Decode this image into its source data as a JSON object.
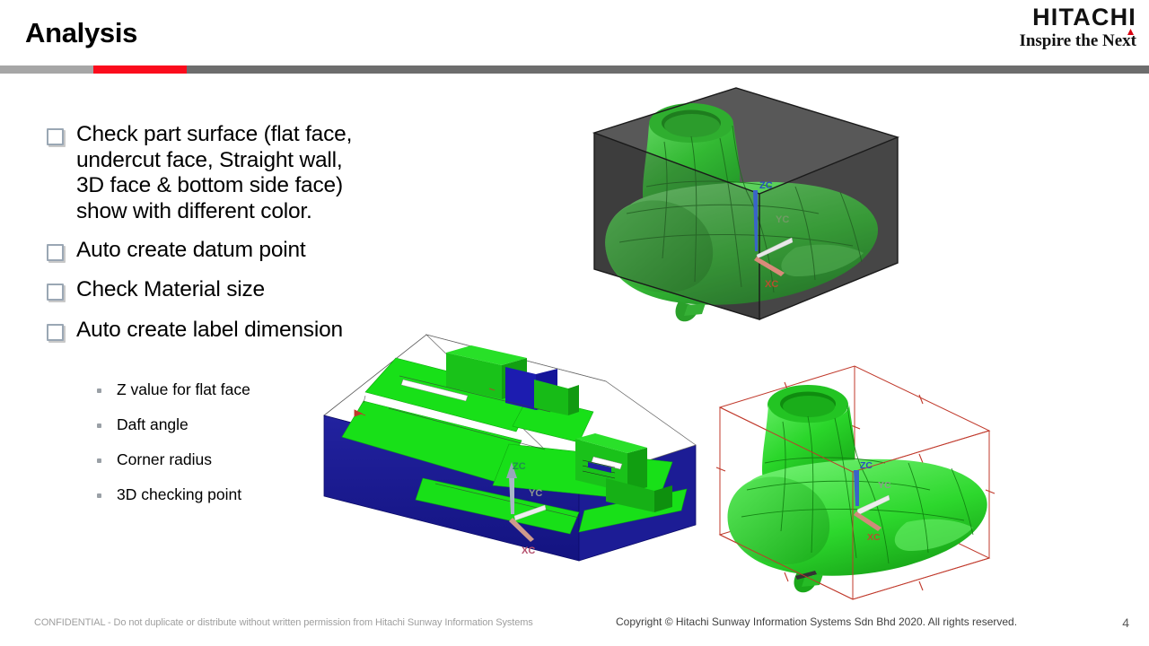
{
  "header": {
    "title": "Analysis",
    "logo_main": "HITACHI",
    "logo_tagline": "Inspire the Next"
  },
  "divider": {
    "segment_colors": [
      "#a6a6a6",
      "#fb0b1c",
      "#6d6d6d"
    ]
  },
  "content": {
    "bullets": [
      "Check part surface (flat face,\nundercut face, Straight wall,\n3D face & bottom side face)\nshow with different color.",
      "Auto create datum point",
      "Check Material size",
      "Auto create label dimension"
    ],
    "sub_bullets": [
      "Z value for flat face",
      "Daft angle",
      "Corner radius",
      "3D checking point"
    ]
  },
  "figures": {
    "top_right": {
      "caption": "green part inside dark transparent bounding box",
      "part_color": "#31b431",
      "box_color": "#3a3a3a",
      "axis_labels": [
        "ZC",
        "YC",
        "XC"
      ]
    },
    "bottom_left": {
      "caption": "mold plate with colored faces",
      "flat_face_color": "#16e016",
      "side_face_color": "#1a1a9e",
      "neutral_face_color": "#ffffff",
      "axis_labels": [
        "ZC",
        "YC",
        "XC"
      ]
    },
    "bottom_right": {
      "caption": "green part with red dimension bounding box",
      "part_color": "#22dd22",
      "box_color": "#c0392b",
      "axis_labels": [
        "ZC",
        "YC",
        "XC"
      ]
    }
  },
  "footer": {
    "confidential": "CONFIDENTIAL - Do not duplicate or distribute without written permission from Hitachi Sunway Information Systems",
    "copyright": "Copyright © Hitachi Sunway Information Systems Sdn Bhd 2020. All rights reserved.",
    "page_number": "4"
  }
}
